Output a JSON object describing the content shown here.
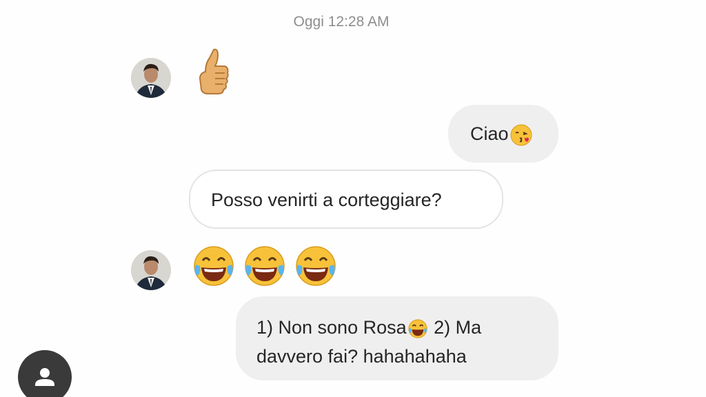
{
  "chat": {
    "timestamp": "Oggi 12:28 AM",
    "messages": [
      {
        "sender": "them",
        "type": "emoji",
        "emoji": "thumbs-up-icon"
      },
      {
        "sender": "me",
        "type": "text",
        "text": "Ciao",
        "emoji": "kissing-face-icon"
      },
      {
        "sender": "them",
        "type": "text",
        "text": "Posso venirti a corteggiare?"
      },
      {
        "sender": "them",
        "type": "emoji",
        "emoji": "tears-of-joy-icon",
        "count": 3
      },
      {
        "sender": "me",
        "type": "text",
        "line1_a": "1) Non sono Rosa",
        "line1_b": " 2) Ma",
        "line2": "davvero fai? hahahahaha"
      }
    ]
  },
  "colors": {
    "outgoing_bubble": "#efefef",
    "incoming_bubble_border": "#e3e3e3",
    "timestamp": "#8e8e8e",
    "text": "#262626"
  }
}
